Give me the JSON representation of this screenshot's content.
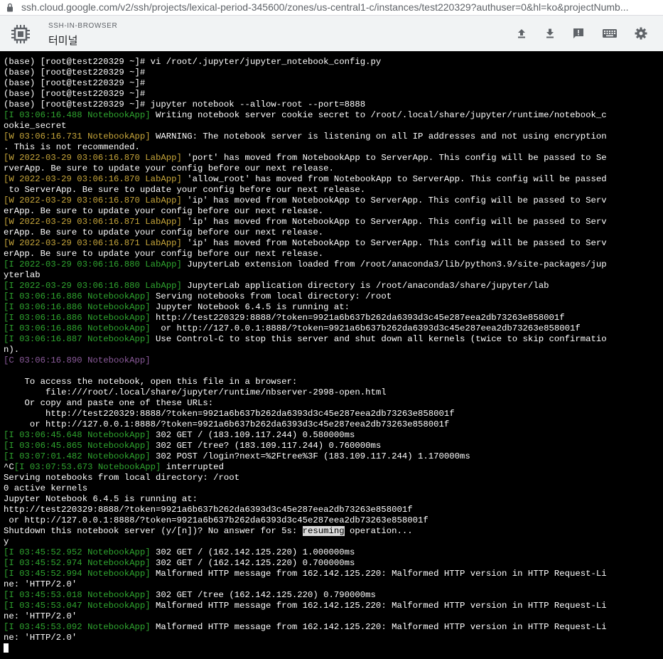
{
  "browser": {
    "url": "ssh.cloud.google.com/v2/ssh/projects/lexical-period-345600/zones/us-central1-c/instances/test220329?authuser=0&hl=ko&projectNumb..."
  },
  "app": {
    "subtitle": "SSH-IN-BROWSER",
    "title": "터미널",
    "toolbar": [
      {
        "icon": "upload-icon"
      },
      {
        "icon": "download-icon"
      },
      {
        "icon": "feedback-icon"
      },
      {
        "icon": "keyboard-icon"
      },
      {
        "icon": "settings-icon"
      }
    ]
  },
  "terminal": {
    "lines": [
      [
        {
          "t": "(base) [root@test220329 ~]# vi /root/.jupyter/jupyter_notebook_config.py"
        }
      ],
      [
        {
          "t": "(base) [root@test220329 ~]#"
        }
      ],
      [
        {
          "t": "(base) [root@test220329 ~]#"
        }
      ],
      [
        {
          "t": "(base) [root@test220329 ~]#"
        }
      ],
      [
        {
          "t": "(base) [root@test220329 ~]# jupyter notebook --allow-root --port=8888"
        }
      ],
      [
        {
          "t": "[I 03:06:16.488 NotebookApp]",
          "c": "g"
        },
        {
          "t": " Writing notebook server cookie secret to /root/.local/share/jupyter/runtime/notebook_c"
        }
      ],
      [
        {
          "t": "ookie_secret"
        }
      ],
      [
        {
          "t": "[W 03:06:16.731 NotebookApp]",
          "c": "y"
        },
        {
          "t": " WARNING: The notebook server is listening on all IP addresses and not using encryption"
        }
      ],
      [
        {
          "t": ". This is not recommended."
        }
      ],
      [
        {
          "t": "[W 2022-03-29 03:06:16.870 LabApp]",
          "c": "y"
        },
        {
          "t": " 'port' has moved from NotebookApp to ServerApp. This config will be passed to Se"
        }
      ],
      [
        {
          "t": "rverApp. Be sure to update your config before our next release."
        }
      ],
      [
        {
          "t": "[W 2022-03-29 03:06:16.870 LabApp]",
          "c": "y"
        },
        {
          "t": " 'allow_root' has moved from NotebookApp to ServerApp. This config will be passed"
        }
      ],
      [
        {
          "t": " to ServerApp. Be sure to update your config before our next release."
        }
      ],
      [
        {
          "t": "[W 2022-03-29 03:06:16.870 LabApp]",
          "c": "y"
        },
        {
          "t": " 'ip' has moved from NotebookApp to ServerApp. This config will be passed to Serv"
        }
      ],
      [
        {
          "t": "erApp. Be sure to update your config before our next release."
        }
      ],
      [
        {
          "t": "[W 2022-03-29 03:06:16.871 LabApp]",
          "c": "y"
        },
        {
          "t": " 'ip' has moved from NotebookApp to ServerApp. This config will be passed to Serv"
        }
      ],
      [
        {
          "t": "erApp. Be sure to update your config before our next release."
        }
      ],
      [
        {
          "t": "[W 2022-03-29 03:06:16.871 LabApp]",
          "c": "y"
        },
        {
          "t": " 'ip' has moved from NotebookApp to ServerApp. This config will be passed to Serv"
        }
      ],
      [
        {
          "t": "erApp. Be sure to update your config before our next release."
        }
      ],
      [
        {
          "t": "[I 2022-03-29 03:06:16.880 LabApp]",
          "c": "g"
        },
        {
          "t": " JupyterLab extension loaded from /root/anaconda3/lib/python3.9/site-packages/jup"
        }
      ],
      [
        {
          "t": "yterlab"
        }
      ],
      [
        {
          "t": "[I 2022-03-29 03:06:16.880 LabApp]",
          "c": "g"
        },
        {
          "t": " JupyterLab application directory is /root/anaconda3/share/jupyter/lab"
        }
      ],
      [
        {
          "t": "[I 03:06:16.886 NotebookApp]",
          "c": "g"
        },
        {
          "t": " Serving notebooks from local directory: /root"
        }
      ],
      [
        {
          "t": "[I 03:06:16.886 NotebookApp]",
          "c": "g"
        },
        {
          "t": " Jupyter Notebook 6.4.5 is running at:"
        }
      ],
      [
        {
          "t": "[I 03:06:16.886 NotebookApp]",
          "c": "g"
        },
        {
          "t": " http://test220329:8888/?token=9921a6b637b262da6393d3c45e287eea2db73263e858001f"
        }
      ],
      [
        {
          "t": "[I 03:06:16.886 NotebookApp]",
          "c": "g"
        },
        {
          "t": "  or http://127.0.0.1:8888/?token=9921a6b637b262da6393d3c45e287eea2db73263e858001f"
        }
      ],
      [
        {
          "t": "[I 03:06:16.887 NotebookApp]",
          "c": "g"
        },
        {
          "t": " Use Control-C to stop this server and shut down all kernels (twice to skip confirmatio"
        }
      ],
      [
        {
          "t": "n)."
        }
      ],
      [
        {
          "t": "[C 03:06:16.890 NotebookApp]",
          "c": "p"
        }
      ],
      [
        {
          "t": ""
        }
      ],
      [
        {
          "t": "    To access the notebook, open this file in a browser:"
        }
      ],
      [
        {
          "t": "        file:///root/.local/share/jupyter/runtime/nbserver-2998-open.html"
        }
      ],
      [
        {
          "t": "    Or copy and paste one of these URLs:"
        }
      ],
      [
        {
          "t": "        http://test220329:8888/?token=9921a6b637b262da6393d3c45e287eea2db73263e858001f"
        }
      ],
      [
        {
          "t": "     or http://127.0.0.1:8888/?token=9921a6b637b262da6393d3c45e287eea2db73263e858001f"
        }
      ],
      [
        {
          "t": "[I 03:06:45.648 NotebookApp]",
          "c": "g"
        },
        {
          "t": " 302 GET / (183.109.117.244) 0.580000ms"
        }
      ],
      [
        {
          "t": "[I 03:06:45.865 NotebookApp]",
          "c": "g"
        },
        {
          "t": " 302 GET /tree? (183.109.117.244) 0.760000ms"
        }
      ],
      [
        {
          "t": "[I 03:07:01.482 NotebookApp]",
          "c": "g"
        },
        {
          "t": " 302 POST /login?next=%2Ftree%3F (183.109.117.244) 1.170000ms"
        }
      ],
      [
        {
          "t": "^C"
        },
        {
          "t": "[I 03:07:53.673 NotebookApp]",
          "c": "g"
        },
        {
          "t": " interrupted"
        }
      ],
      [
        {
          "t": "Serving notebooks from local directory: /root"
        }
      ],
      [
        {
          "t": "0 active kernels"
        }
      ],
      [
        {
          "t": "Jupyter Notebook 6.4.5 is running at:"
        }
      ],
      [
        {
          "t": "http://test220329:8888/?token=9921a6b637b262da6393d3c45e287eea2db73263e858001f"
        }
      ],
      [
        {
          "t": " or http://127.0.0.1:8888/?token=9921a6b637b262da6393d3c45e287eea2db73263e858001f"
        }
      ],
      [
        {
          "t": "Shutdown this notebook server (y/[n])? No answer for 5s: "
        },
        {
          "t": "resuming",
          "c": "hl"
        },
        {
          "t": " operation..."
        }
      ],
      [
        {
          "t": "y"
        }
      ],
      [
        {
          "t": "[I 03:45:52.952 NotebookApp]",
          "c": "g"
        },
        {
          "t": " 302 GET / (162.142.125.220) 1.000000ms"
        }
      ],
      [
        {
          "t": "[I 03:45:52.974 NotebookApp]",
          "c": "g"
        },
        {
          "t": " 302 GET / (162.142.125.220) 0.700000ms"
        }
      ],
      [
        {
          "t": "[I 03:45:52.994 NotebookApp]",
          "c": "g"
        },
        {
          "t": " Malformed HTTP message from 162.142.125.220: Malformed HTTP version in HTTP Request-Li"
        }
      ],
      [
        {
          "t": "ne: 'HTTP/2.0'"
        }
      ],
      [
        {
          "t": "[I 03:45:53.018 NotebookApp]",
          "c": "g"
        },
        {
          "t": " 302 GET /tree (162.142.125.220) 0.790000ms"
        }
      ],
      [
        {
          "t": "[I 03:45:53.047 NotebookApp]",
          "c": "g"
        },
        {
          "t": " Malformed HTTP message from 162.142.125.220: Malformed HTTP version in HTTP Request-Li"
        }
      ],
      [
        {
          "t": "ne: 'HTTP/2.0'"
        }
      ],
      [
        {
          "t": "[I 03:45:53.092 NotebookApp]",
          "c": "g"
        },
        {
          "t": " Malformed HTTP message from 162.142.125.220: Malformed HTTP version in HTTP Request-Li"
        }
      ],
      [
        {
          "t": "ne: 'HTTP/2.0'"
        }
      ]
    ]
  },
  "colors": {
    "info": "#2fa52f",
    "warning": "#c6a53a",
    "critical": "#8a5a9a",
    "terminal_bg": "#000000",
    "terminal_fg": "#ffffff"
  }
}
